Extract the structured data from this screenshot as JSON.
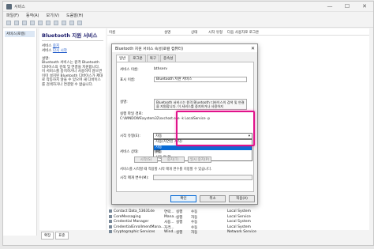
{
  "window": {
    "title": "서비스",
    "controls": [
      "—",
      "☐",
      "✕"
    ]
  },
  "menu": [
    "파일(F)",
    "동작(A)",
    "보기(V)",
    "도움말(H)"
  ],
  "tree": {
    "item": "서비스(로컬)"
  },
  "detail": {
    "title": "Bluetooth 지원 서비스",
    "stop_prefix": "서비스",
    "stop_link": "중지",
    "restart_prefix": "서비스",
    "restart_link": "다시 시작",
    "desc_head": "설명:",
    "desc_body": "Bluetooth 서비스는 원격 Bluetooth 디바이스의 검색 및 연결을 지원합니다. 이 서비스를 중지하거나 사용하지 않으면 이미 설치된 Bluetooth 디바이스가 제대로 작동하지 않을 수 있으며 새 디바이스를 검색하거나 연결할 수 없습니다."
  },
  "columns": [
    "이름",
    "설명",
    "상태",
    "시작 유형",
    "다음 사용자로 로그온"
  ],
  "services": [
    {
      "name": "Contact Data_53631de",
      "desc": "연락...",
      "status": "실행",
      "start": "수동",
      "logon": "Local System"
    },
    {
      "name": "CoreMessaging",
      "desc": "Mana...",
      "status": "실행",
      "start": "자동",
      "logon": "Local Service"
    },
    {
      "name": "Credential Manager",
      "desc": "사용...",
      "status": "실행",
      "start": "수동",
      "logon": "Local System"
    },
    {
      "name": "CredentialEnrollmentMana...",
      "desc": "자격...",
      "status": "",
      "start": "수동",
      "logon": "Local System"
    },
    {
      "name": "Cryptographic Services",
      "desc": "Wind...",
      "status": "실행",
      "start": "자동",
      "logon": "Network Service"
    }
  ],
  "bottom_tabs": [
    "확장",
    "표준"
  ],
  "dialog": {
    "title": "Bluetooth 지원 서비스 속성(로컬 컴퓨터)",
    "close": "✕",
    "tabs": [
      "일반",
      "로그온",
      "복구",
      "종속성"
    ],
    "service_name_label": "서비스 이름:",
    "service_name": "bthserv",
    "display_name_label": "표시 이름:",
    "display_name": "Bluetooth 지원 서비스",
    "desc_label": "설명:",
    "desc": "Bluetooth 서비스는 원격 Bluetooth 디바이스의 검색 및 연결을 지원합니다. 이 서비스를 중지하거나 사용하지",
    "path_label": "실행 파일 경로:",
    "path": "C:\\WINDOWS\\system32\\svchost.exe -k LocalService -p",
    "startup_label": "시작 유형(E):",
    "startup_value": "자동",
    "startup_options": [
      "자동(지연된 시작)",
      "자동",
      "수동",
      "사용 안 함"
    ],
    "status_label": "서비스 상태:",
    "status_value": "실행",
    "buttons": [
      "시작(S)",
      "중지(T)",
      "일시 중지(P)"
    ],
    "hint": "서비스를 시작할 때 적용할 시작 매개 변수를 지정할 수 있습니다.",
    "param_label": "시작 매개 변수(M):",
    "ok": "확인",
    "cancel": "취소",
    "apply": "적용(A)"
  }
}
